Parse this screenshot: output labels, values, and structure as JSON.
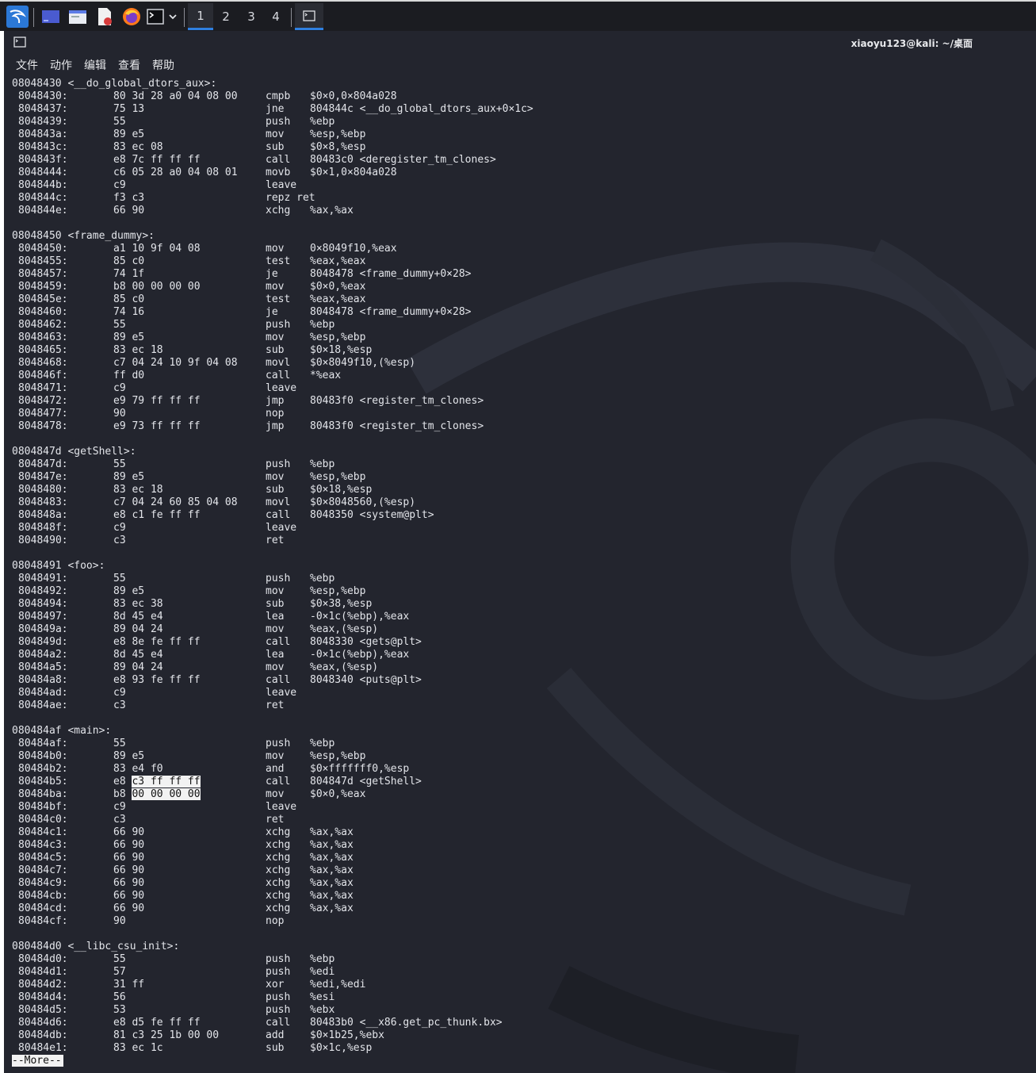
{
  "taskbar": {
    "workspaces": [
      "1",
      "2",
      "3",
      "4"
    ],
    "active_workspace": "1",
    "launchers": [
      "kali-menu-icon",
      "desktop-icon",
      "file-manager-icon",
      "text-editor-icon",
      "firefox-icon",
      "terminal-icon",
      "dropdown-icon"
    ]
  },
  "window": {
    "title": "xiaoyu123@kali: ~/桌面"
  },
  "menu": [
    "文件",
    "动作",
    "编辑",
    "查看",
    "帮助"
  ],
  "pager": "--More--",
  "sections": [
    {
      "header": "08048430 <__do_global_dtors_aux>:",
      "rows": [
        {
          "addr": "8048430:",
          "bytes": "80 3d 28 a0 04 08 00",
          "mn": "cmpb",
          "op": "$0×0,0×804a028"
        },
        {
          "addr": "8048437:",
          "bytes": "75 13",
          "mn": "jne",
          "op": "804844c <__do_global_dtors_aux+0×1c>"
        },
        {
          "addr": "8048439:",
          "bytes": "55",
          "mn": "push",
          "op": "%ebp"
        },
        {
          "addr": "804843a:",
          "bytes": "89 e5",
          "mn": "mov",
          "op": "%esp,%ebp"
        },
        {
          "addr": "804843c:",
          "bytes": "83 ec 08",
          "mn": "sub",
          "op": "$0×8,%esp"
        },
        {
          "addr": "804843f:",
          "bytes": "e8 7c ff ff ff",
          "mn": "call",
          "op": "80483c0 <deregister_tm_clones>"
        },
        {
          "addr": "8048444:",
          "bytes": "c6 05 28 a0 04 08 01",
          "mn": "movb",
          "op": "$0×1,0×804a028"
        },
        {
          "addr": "804844b:",
          "bytes": "c9",
          "mn": "leave",
          "op": ""
        },
        {
          "addr": "804844c:",
          "bytes": "f3 c3",
          "mn": "repz ret",
          "op": ""
        },
        {
          "addr": "804844e:",
          "bytes": "66 90",
          "mn": "xchg",
          "op": "%ax,%ax"
        }
      ]
    },
    {
      "header": "08048450 <frame_dummy>:",
      "rows": [
        {
          "addr": "8048450:",
          "bytes": "a1 10 9f 04 08",
          "mn": "mov",
          "op": "0×8049f10,%eax"
        },
        {
          "addr": "8048455:",
          "bytes": "85 c0",
          "mn": "test",
          "op": "%eax,%eax"
        },
        {
          "addr": "8048457:",
          "bytes": "74 1f",
          "mn": "je",
          "op": "8048478 <frame_dummy+0×28>"
        },
        {
          "addr": "8048459:",
          "bytes": "b8 00 00 00 00",
          "mn": "mov",
          "op": "$0×0,%eax"
        },
        {
          "addr": "804845e:",
          "bytes": "85 c0",
          "mn": "test",
          "op": "%eax,%eax"
        },
        {
          "addr": "8048460:",
          "bytes": "74 16",
          "mn": "je",
          "op": "8048478 <frame_dummy+0×28>"
        },
        {
          "addr": "8048462:",
          "bytes": "55",
          "mn": "push",
          "op": "%ebp"
        },
        {
          "addr": "8048463:",
          "bytes": "89 e5",
          "mn": "mov",
          "op": "%esp,%ebp"
        },
        {
          "addr": "8048465:",
          "bytes": "83 ec 18",
          "mn": "sub",
          "op": "$0×18,%esp"
        },
        {
          "addr": "8048468:",
          "bytes": "c7 04 24 10 9f 04 08",
          "mn": "movl",
          "op": "$0×8049f10,(%esp)"
        },
        {
          "addr": "804846f:",
          "bytes": "ff d0",
          "mn": "call",
          "op": "*%eax"
        },
        {
          "addr": "8048471:",
          "bytes": "c9",
          "mn": "leave",
          "op": ""
        },
        {
          "addr": "8048472:",
          "bytes": "e9 79 ff ff ff",
          "mn": "jmp",
          "op": "80483f0 <register_tm_clones>"
        },
        {
          "addr": "8048477:",
          "bytes": "90",
          "mn": "nop",
          "op": ""
        },
        {
          "addr": "8048478:",
          "bytes": "e9 73 ff ff ff",
          "mn": "jmp",
          "op": "80483f0 <register_tm_clones>"
        }
      ]
    },
    {
      "header": "0804847d <getShell>:",
      "rows": [
        {
          "addr": "804847d:",
          "bytes": "55",
          "mn": "push",
          "op": "%ebp"
        },
        {
          "addr": "804847e:",
          "bytes": "89 e5",
          "mn": "mov",
          "op": "%esp,%ebp"
        },
        {
          "addr": "8048480:",
          "bytes": "83 ec 18",
          "mn": "sub",
          "op": "$0×18,%esp"
        },
        {
          "addr": "8048483:",
          "bytes": "c7 04 24 60 85 04 08",
          "mn": "movl",
          "op": "$0×8048560,(%esp)"
        },
        {
          "addr": "804848a:",
          "bytes": "e8 c1 fe ff ff",
          "mn": "call",
          "op": "8048350 <system@plt>"
        },
        {
          "addr": "804848f:",
          "bytes": "c9",
          "mn": "leave",
          "op": ""
        },
        {
          "addr": "8048490:",
          "bytes": "c3",
          "mn": "ret",
          "op": ""
        }
      ]
    },
    {
      "header": "08048491 <foo>:",
      "rows": [
        {
          "addr": "8048491:",
          "bytes": "55",
          "mn": "push",
          "op": "%ebp"
        },
        {
          "addr": "8048492:",
          "bytes": "89 e5",
          "mn": "mov",
          "op": "%esp,%ebp"
        },
        {
          "addr": "8048494:",
          "bytes": "83 ec 38",
          "mn": "sub",
          "op": "$0×38,%esp"
        },
        {
          "addr": "8048497:",
          "bytes": "8d 45 e4",
          "mn": "lea",
          "op": "-0×1c(%ebp),%eax"
        },
        {
          "addr": "804849a:",
          "bytes": "89 04 24",
          "mn": "mov",
          "op": "%eax,(%esp)"
        },
        {
          "addr": "804849d:",
          "bytes": "e8 8e fe ff ff",
          "mn": "call",
          "op": "8048330 <gets@plt>"
        },
        {
          "addr": "80484a2:",
          "bytes": "8d 45 e4",
          "mn": "lea",
          "op": "-0×1c(%ebp),%eax"
        },
        {
          "addr": "80484a5:",
          "bytes": "89 04 24",
          "mn": "mov",
          "op": "%eax,(%esp)"
        },
        {
          "addr": "80484a8:",
          "bytes": "e8 93 fe ff ff",
          "mn": "call",
          "op": "8048340 <puts@plt>"
        },
        {
          "addr": "80484ad:",
          "bytes": "c9",
          "mn": "leave",
          "op": ""
        },
        {
          "addr": "80484ae:",
          "bytes": "c3",
          "mn": "ret",
          "op": ""
        }
      ]
    },
    {
      "header": "080484af <main>:",
      "rows": [
        {
          "addr": "80484af:",
          "bytes": "55",
          "mn": "push",
          "op": "%ebp"
        },
        {
          "addr": "80484b0:",
          "bytes": "89 e5",
          "mn": "mov",
          "op": "%esp,%ebp"
        },
        {
          "addr": "80484b2:",
          "bytes": "83 e4 f0",
          "mn": "and",
          "op": "$0×fffffff0,%esp"
        },
        {
          "addr": "80484b5:",
          "bytes": "e8 ",
          "bytes_sel": "c3 ff ff ff",
          "mn": "call",
          "op": "804847d <getShell>"
        },
        {
          "addr": "80484ba:",
          "bytes": "b8 ",
          "bytes_sel": "00 00 00 00",
          "mn": "mov",
          "op": "$0×0,%eax"
        },
        {
          "addr": "80484bf:",
          "bytes": "c9",
          "mn": "leave",
          "op": ""
        },
        {
          "addr": "80484c0:",
          "bytes": "c3",
          "mn": "ret",
          "op": ""
        },
        {
          "addr": "80484c1:",
          "bytes": "66 90",
          "mn": "xchg",
          "op": "%ax,%ax"
        },
        {
          "addr": "80484c3:",
          "bytes": "66 90",
          "mn": "xchg",
          "op": "%ax,%ax"
        },
        {
          "addr": "80484c5:",
          "bytes": "66 90",
          "mn": "xchg",
          "op": "%ax,%ax"
        },
        {
          "addr": "80484c7:",
          "bytes": "66 90",
          "mn": "xchg",
          "op": "%ax,%ax"
        },
        {
          "addr": "80484c9:",
          "bytes": "66 90",
          "mn": "xchg",
          "op": "%ax,%ax"
        },
        {
          "addr": "80484cb:",
          "bytes": "66 90",
          "mn": "xchg",
          "op": "%ax,%ax"
        },
        {
          "addr": "80484cd:",
          "bytes": "66 90",
          "mn": "xchg",
          "op": "%ax,%ax"
        },
        {
          "addr": "80484cf:",
          "bytes": "90",
          "mn": "nop",
          "op": ""
        }
      ]
    },
    {
      "header": "080484d0 <__libc_csu_init>:",
      "rows": [
        {
          "addr": "80484d0:",
          "bytes": "55",
          "mn": "push",
          "op": "%ebp"
        },
        {
          "addr": "80484d1:",
          "bytes": "57",
          "mn": "push",
          "op": "%edi"
        },
        {
          "addr": "80484d2:",
          "bytes": "31 ff",
          "mn": "xor",
          "op": "%edi,%edi"
        },
        {
          "addr": "80484d4:",
          "bytes": "56",
          "mn": "push",
          "op": "%esi"
        },
        {
          "addr": "80484d5:",
          "bytes": "53",
          "mn": "push",
          "op": "%ebx"
        },
        {
          "addr": "80484d6:",
          "bytes": "e8 d5 fe ff ff",
          "mn": "call",
          "op": "80483b0 <__x86.get_pc_thunk.bx>"
        },
        {
          "addr": "80484db:",
          "bytes": "81 c3 25 1b 00 00",
          "mn": "add",
          "op": "$0×1b25,%ebx"
        },
        {
          "addr": "80484e1:",
          "bytes": "83 ec 1c",
          "mn": "sub",
          "op": "$0×1c,%esp"
        }
      ]
    }
  ]
}
